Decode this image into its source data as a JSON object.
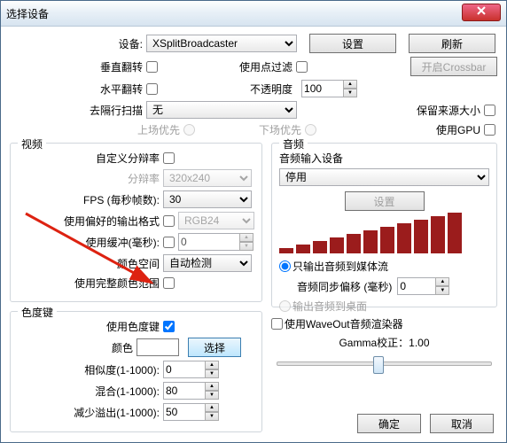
{
  "window": {
    "title": "选择设备"
  },
  "top": {
    "device_label": "设备:",
    "device_value": "XSplitBroadcaster",
    "settings_btn": "设置",
    "refresh_btn": "刷新",
    "vflip": "垂直翻转",
    "pointfilter": "使用点过滤",
    "crossbar_btn": "开启Crossbar",
    "hflip": "水平翻转",
    "opacity_label": "不透明度",
    "opacity_value": "100",
    "deinterlace_label": "去隔行扫描",
    "deinterlace_value": "无",
    "keep_source_size": "保留来源大小",
    "upper_first": "上场优先",
    "lower_first": "下场优先",
    "use_gpu": "使用GPU"
  },
  "video": {
    "legend": "视频",
    "custom_res": "自定义分辩率",
    "res_label": "分辩率",
    "res_value": "320x240",
    "fps_label": "FPS (毎秒帧数):",
    "fps_value": "30",
    "fmt_label": "使用偏好的输出格式",
    "fmt_value": "RGB24",
    "buf_label": "使用缓冲(毫秒):",
    "buf_value": "0",
    "cs_label": "颜色空间",
    "cs_value": "自动检测",
    "full_range": "使用完整颜色范围"
  },
  "audio": {
    "legend": "音频",
    "input_label": "音频输入设备",
    "input_value": "停用",
    "settings_btn": "设置",
    "out_media": "只输出音频到媒体流",
    "sync_label": "音频同步偏移 (毫秒)",
    "sync_value": "0",
    "out_desktop": "输出音频到桌面",
    "waveout": "使用WaveOut音频渲染器",
    "gamma_label": "Gamma校正：",
    "gamma_value": "1.00"
  },
  "chroma": {
    "legend": "色度键",
    "use": "使用色度键",
    "color_label": "颜色",
    "choose_btn": "选择",
    "sim_label": "相似度(1-1000):",
    "sim_value": "0",
    "blend_label": "混合(1-1000):",
    "blend_value": "80",
    "spill_label": "减少溢出(1-1000):",
    "spill_value": "50"
  },
  "footer": {
    "ok": "确定",
    "cancel": "取消"
  }
}
